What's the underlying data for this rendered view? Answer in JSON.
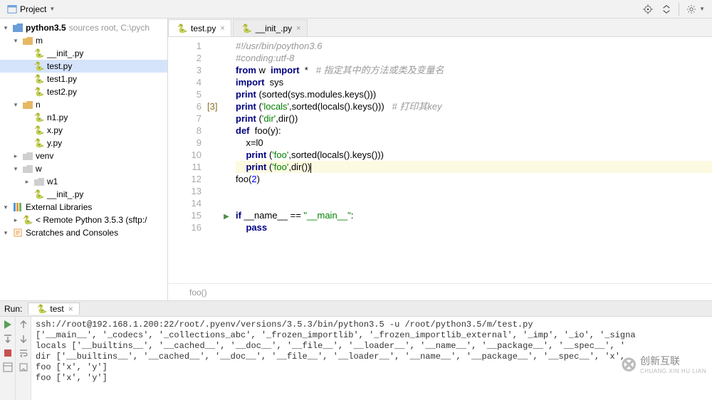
{
  "toolbar": {
    "project_label": "Project"
  },
  "tree": {
    "root": {
      "name": "python3.5",
      "hint": "sources root, C:\\pych"
    },
    "m": {
      "name": "m"
    },
    "m_children": [
      "__init_.py",
      "test.py",
      "test1.py",
      "test2.py"
    ],
    "n": {
      "name": "n"
    },
    "n_children": [
      "n1.py",
      "x.py",
      "y.py"
    ],
    "venv": "venv",
    "w": {
      "name": "w"
    },
    "w_children": [
      "w1",
      "__init_.py"
    ],
    "ext": "External Libraries",
    "remote": "< Remote Python 3.5.3 (sftp:/",
    "scratch": "Scratches and Consoles"
  },
  "tabs": [
    {
      "name": "test.py",
      "active": true
    },
    {
      "name": "__init_.py",
      "active": false
    }
  ],
  "code": {
    "lines": [
      {
        "n": 1,
        "html": "<span class='cmt'>#!/usr/bin/poython3.6</span>"
      },
      {
        "n": 2,
        "html": "<span class='cmt'>#conding:utf-8</span>"
      },
      {
        "n": 3,
        "html": "<span class='kw'>from</span> w  <span class='kw'>import</span>  *   <span class='cmt'># 指定其中的方法或类及变量名</span>"
      },
      {
        "n": 4,
        "html": "<span class='kw'>import</span>  sys"
      },
      {
        "n": 5,
        "html": "<span class='kw'>print</span> (sorted(sys.modules.keys()))"
      },
      {
        "n": 6,
        "html": "<span class='kw'>print</span> (<span class='str'>'locals'</span>,sorted(locals().keys()))   <span class='cmt'># 打印其key</span>"
      },
      {
        "n": 7,
        "html": "<span class='kw'>print</span> (<span class='str'>'dir'</span>,dir())"
      },
      {
        "n": 8,
        "html": "<span class='kw'>def</span>  foo(y):"
      },
      {
        "n": 9,
        "html": "    x=l0"
      },
      {
        "n": 10,
        "html": "    <span class='kw'>print</span> (<span class='str'>'foo'</span>,sorted(locals().keys()))"
      },
      {
        "n": 11,
        "html": "    <span class='kw'>print</span> (<span class='str'>'foo'</span>,dir())<span class='caret'></span>",
        "cur": true
      },
      {
        "n": 12,
        "html": "foo(<span class='num'>2</span>)"
      },
      {
        "n": 13,
        "html": ""
      },
      {
        "n": 14,
        "html": ""
      },
      {
        "n": 15,
        "html": "<span class='kw'>if</span> __name__ == <span class='str'>\"__main__\"</span>:"
      },
      {
        "n": 16,
        "html": "    <span class='kw'>pass</span>"
      }
    ],
    "gutter_marks": {
      "6": "[3]"
    },
    "run_glyph": {
      "15": "▶"
    }
  },
  "crumb": "foo()",
  "run": {
    "label": "Run:",
    "tab": "test",
    "output": [
      "ssh://root@192.168.1.200:22/root/.pyenv/versions/3.5.3/bin/python3.5 -u /root/python3.5/m/test.py",
      "['__main__', '_codecs', '_collections_abc', '_frozen_importlib', '_frozen_importlib_external', '_imp', '_io', '_signa",
      "locals ['__builtins__', '__cached__', '__doc__', '__file__', '__loader__', '__name__', '__package__', '__spec__', '",
      "dir ['__builtins__', '__cached__', '__doc__', '__file__', '__loader__', '__name__', '__package__', '__spec__', 'x',",
      "foo ['x', 'y']",
      "foo ['x', 'y']"
    ]
  },
  "watermark": {
    "brand": "创新互联",
    "sub": "CHUANG XIN HU LIAN"
  }
}
